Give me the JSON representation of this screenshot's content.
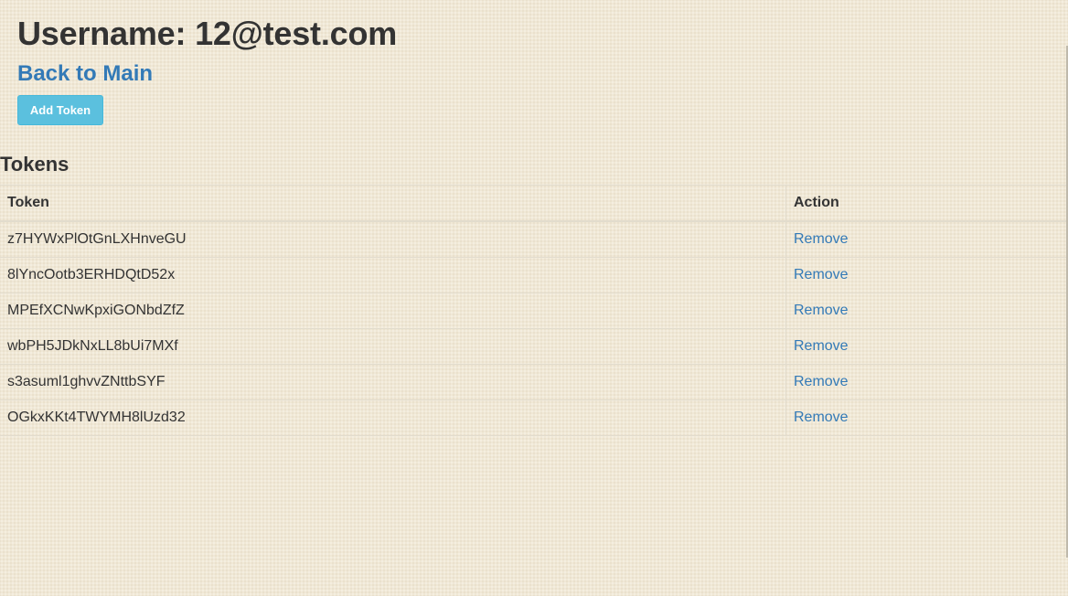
{
  "user": {
    "title": "Username: 12@test.com"
  },
  "nav": {
    "back_label": "Back to Main"
  },
  "toolbar": {
    "add_token_label": "Add Token"
  },
  "tokens_section": {
    "title": "Tokens",
    "columns": [
      "Token",
      "Action"
    ],
    "rows": [
      {
        "token": "z7HYWxPlOtGnLXHnveGU",
        "action": "Remove"
      },
      {
        "token": "8lYncOotb3ERHDQtD52x",
        "action": "Remove"
      },
      {
        "token": "MPEfXCNwKpxiGONbdZfZ",
        "action": "Remove"
      },
      {
        "token": "wbPH5JDkNxLL8bUi7MXf",
        "action": "Remove"
      },
      {
        "token": "s3asuml1ghvvZNttbSYF",
        "action": "Remove"
      },
      {
        "token": "OGkxKKt4TWYMH8lUzd32",
        "action": "Remove"
      }
    ]
  },
  "colors": {
    "background": "#f0e8d6",
    "link": "#337ab7",
    "info_button": "#5bc0de",
    "text": "#333333"
  }
}
